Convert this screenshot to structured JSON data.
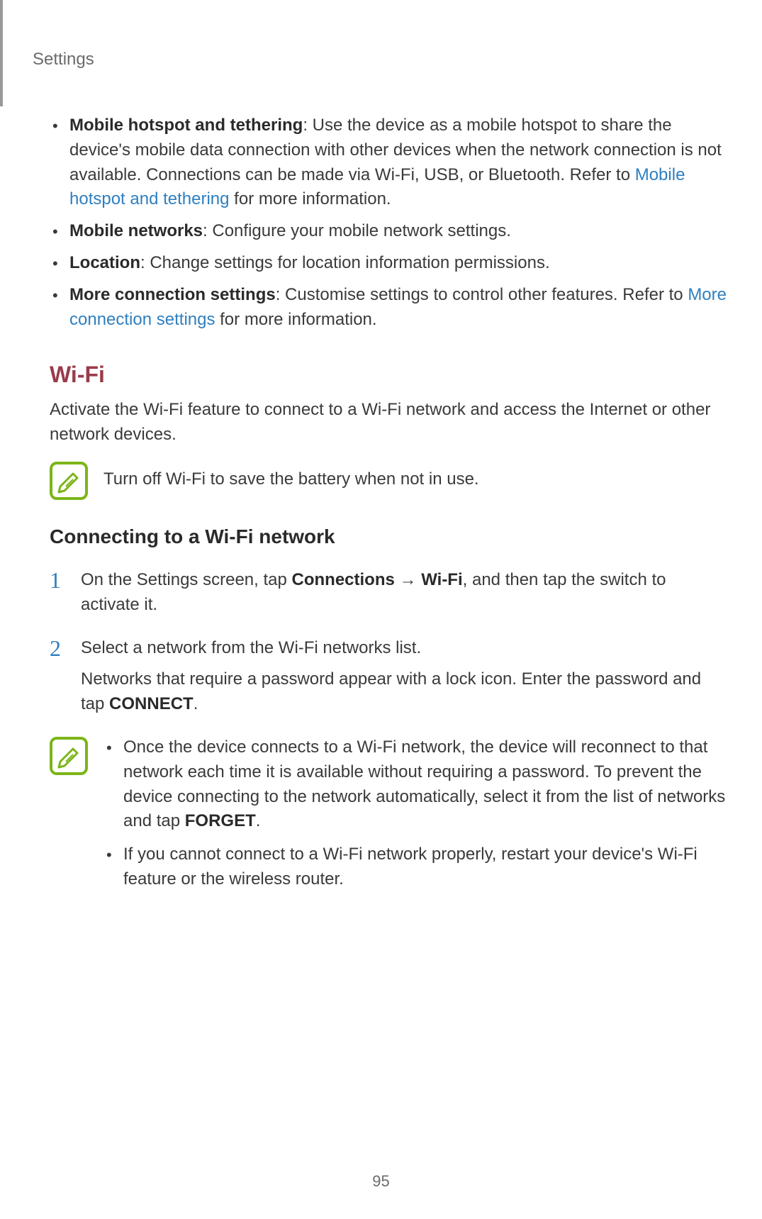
{
  "header": {
    "title": "Settings"
  },
  "bullets": {
    "hotspot": {
      "bold": "Mobile hotspot and tethering",
      "desc": ": Use the device as a mobile hotspot to share the device's mobile data connection with other devices when the network connection is not available. Connections can be made via Wi-Fi, USB, or Bluetooth. Refer to ",
      "link": "Mobile hotspot and tethering",
      "tail": " for more information."
    },
    "mobile_networks": {
      "bold": "Mobile networks",
      "desc": ": Configure your mobile network settings."
    },
    "location": {
      "bold": "Location",
      "desc": ": Change settings for location information permissions."
    },
    "more_conn": {
      "bold": "More connection settings",
      "desc": ": Customise settings to control other features. Refer to ",
      "link": "More connection settings",
      "tail": " for more information."
    }
  },
  "wifi": {
    "heading": "Wi-Fi",
    "intro": "Activate the Wi-Fi feature to connect to a Wi-Fi network and access the Internet or other network devices.",
    "note1": "Turn off Wi-Fi to save the battery when not in use.",
    "subheading": "Connecting to a Wi-Fi network",
    "step1": {
      "pre": "On the Settings screen, tap ",
      "b1": "Connections",
      "arrow": " → ",
      "b2": "Wi-Fi",
      "tail": ", and then tap the switch to activate it."
    },
    "step2": {
      "line1": "Select a network from the Wi-Fi networks list.",
      "line2a": "Networks that require a password appear with a lock icon. Enter the password and tap ",
      "line2b": "CONNECT",
      "line2c": "."
    },
    "note2": {
      "item1a": "Once the device connects to a Wi-Fi network, the device will reconnect to that network each time it is available without requiring a password. To prevent the device connecting to the network automatically, select it from the list of networks and tap ",
      "item1b": "FORGET",
      "item1c": ".",
      "item2": "If you cannot connect to a Wi-Fi network properly, restart your device's Wi-Fi feature or the wireless router."
    }
  },
  "page_number": "95"
}
